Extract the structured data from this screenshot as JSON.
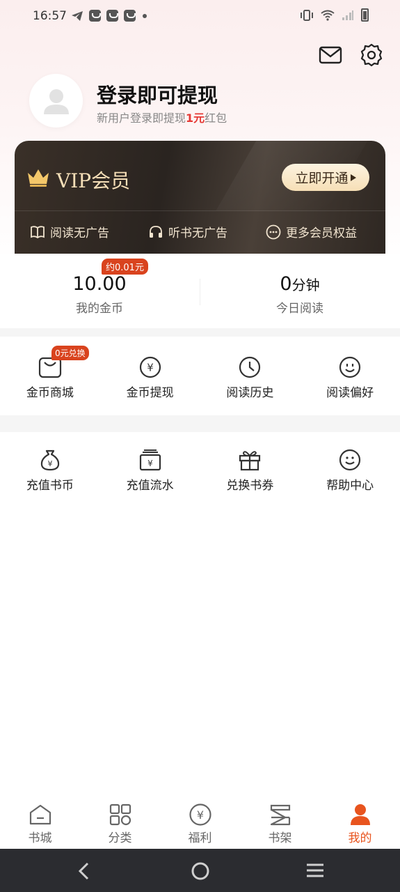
{
  "status_bar": {
    "time": "16:57"
  },
  "profile": {
    "title": "登录即可提现",
    "subtitle_prefix": "新用户登录即提现",
    "subtitle_highlight": "1元",
    "subtitle_suffix": "红包"
  },
  "vip": {
    "title": "VIP会员",
    "button_label": "立即开通",
    "perks": [
      {
        "label": "阅读无广告",
        "icon": "book-icon"
      },
      {
        "label": "听书无广告",
        "icon": "headphones-icon"
      },
      {
        "label": "更多会员权益",
        "icon": "more-icon"
      }
    ]
  },
  "stats": {
    "coin_badge": "约0.01元",
    "coins_value": "10.00",
    "coins_label": "我的金币",
    "read_value": "0",
    "read_unit": "分钟",
    "read_label": "今日阅读"
  },
  "grid1": [
    {
      "label": "金币商城",
      "icon": "bag-icon",
      "badge": "0元兑换"
    },
    {
      "label": "金币提现",
      "icon": "yen-coin-icon"
    },
    {
      "label": "阅读历史",
      "icon": "clock-icon"
    },
    {
      "label": "阅读偏好",
      "icon": "smiley-icon"
    }
  ],
  "grid2": [
    {
      "label": "充值书币",
      "icon": "money-bag-icon"
    },
    {
      "label": "充值流水",
      "icon": "bill-icon"
    },
    {
      "label": "兑换书券",
      "icon": "gift-icon"
    },
    {
      "label": "帮助中心",
      "icon": "support-icon"
    }
  ],
  "bottom_nav": [
    {
      "label": "书城",
      "icon": "home-icon",
      "active": false
    },
    {
      "label": "分类",
      "icon": "category-icon",
      "active": false
    },
    {
      "label": "福利",
      "icon": "welfare-icon",
      "active": false
    },
    {
      "label": "书架",
      "icon": "bookshelf-icon",
      "active": false
    },
    {
      "label": "我的",
      "icon": "user-icon",
      "active": true
    }
  ],
  "colors": {
    "accent": "#e8541e",
    "badge": "#d9431e",
    "vip_gold": "#f6dfb8"
  }
}
